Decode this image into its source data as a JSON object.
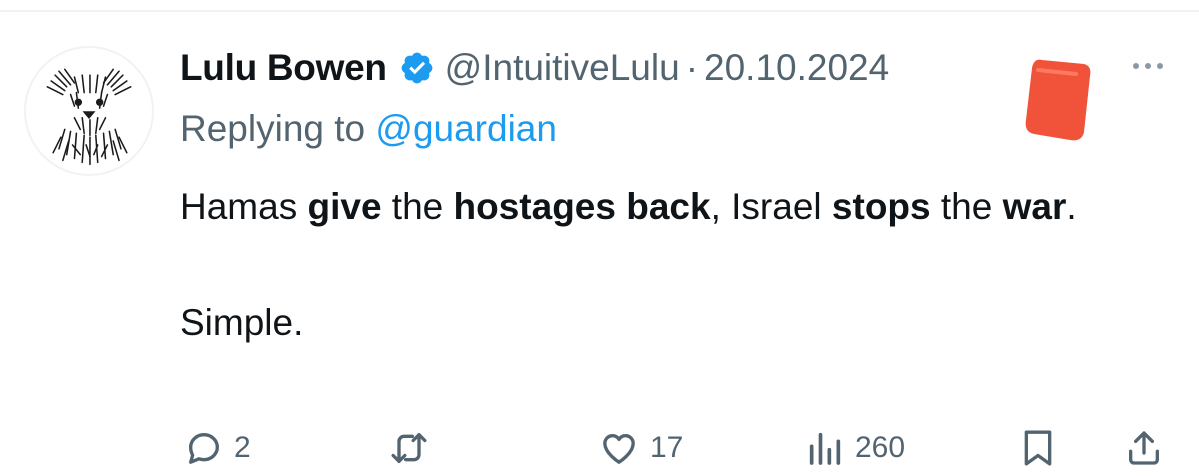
{
  "tweet": {
    "display_name": "Lulu Bowen",
    "handle": "@IntuitiveLulu",
    "separator": "·",
    "date": "20.10.2024",
    "replying_prefix": "Replying to",
    "replying_to": "@guardian",
    "text": {
      "seg1": "Hamas ",
      "seg2": "give",
      "seg3": " the ",
      "seg4": "hostages back",
      "seg5": ", Israel ",
      "seg6": "stops",
      "seg7": " the ",
      "seg8": "war",
      "seg9": ".",
      "para2": "Simple."
    }
  },
  "actions": {
    "reply_count": "2",
    "retweet_count": "",
    "like_count": "17",
    "views_count": "260"
  },
  "icons": {
    "verified": "verified-badge-icon",
    "more": "more-dots-icon",
    "reply": "reply-icon",
    "retweet": "retweet-icon",
    "like": "heart-icon",
    "views": "views-chart-icon",
    "bookmark": "bookmark-icon",
    "share": "share-icon"
  },
  "colors": {
    "accent": "#1d9bf0",
    "secondary_text": "#536471",
    "primary_text": "#0f1419",
    "sticker": "#f0533a"
  }
}
